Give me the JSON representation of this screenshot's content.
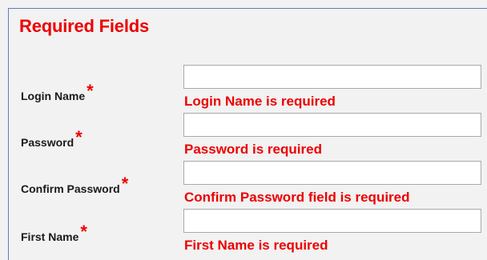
{
  "form": {
    "title": "Required Fields",
    "required_marker": "*",
    "fields": [
      {
        "label": "Login Name",
        "value": "",
        "error": "Login Name is required"
      },
      {
        "label": "Password",
        "value": "",
        "error": "Password is required"
      },
      {
        "label": "Confirm Password",
        "value": "",
        "error": "Confirm Password field is required"
      },
      {
        "label": "First Name",
        "value": "",
        "error": "First Name is required"
      }
    ]
  },
  "colors": {
    "error_red": "#ec0000",
    "panel_border": "#5b7fb5",
    "background": "#f2f2f2"
  }
}
